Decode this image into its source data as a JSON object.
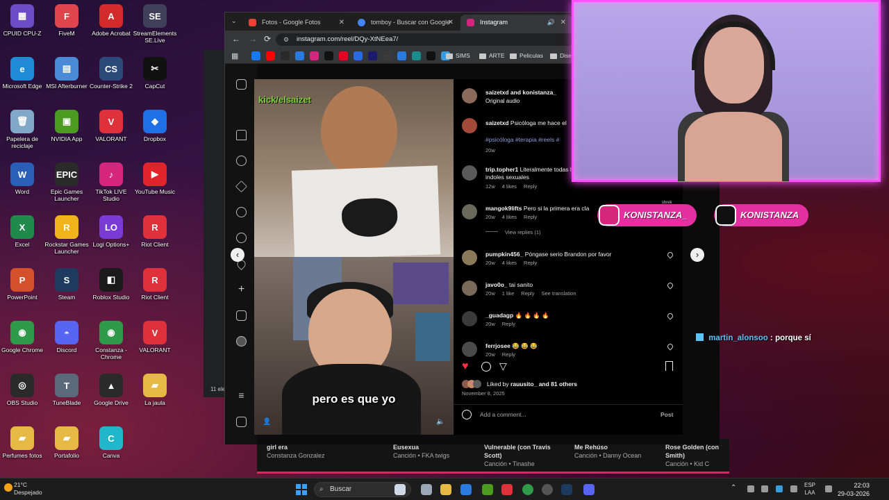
{
  "desktop": {
    "icons": [
      {
        "label": "CPUID CPU-Z",
        "color": "#6d4cc7",
        "glyph": "▦",
        "col": 0,
        "row": 0
      },
      {
        "label": "FiveM",
        "color": "#e0454b",
        "glyph": "F",
        "col": 1,
        "row": 0
      },
      {
        "label": "Adobe Acrobat",
        "color": "#d42a2a",
        "glyph": "A",
        "col": 2,
        "row": 0
      },
      {
        "label": "StreamElements SE.Live",
        "color": "#3f3f5a",
        "glyph": "SE",
        "col": 3,
        "row": 0
      },
      {
        "label": "Microsoft Edge",
        "color": "#1f8ad6",
        "glyph": "e",
        "col": 0,
        "row": 1
      },
      {
        "label": "MSI Afterburner",
        "color": "#4a8bd6",
        "glyph": "▤",
        "col": 1,
        "row": 1
      },
      {
        "label": "Counter-Strike 2",
        "color": "#2b4a7a",
        "glyph": "CS",
        "col": 2,
        "row": 1
      },
      {
        "label": "CapCut",
        "color": "#111111",
        "glyph": "✂",
        "col": 3,
        "row": 1
      },
      {
        "label": "Papelera de reciclaje",
        "color": "#7fa8c9",
        "glyph": "🗑",
        "col": 0,
        "row": 2
      },
      {
        "label": "NVIDIA App",
        "color": "#4a9b1f",
        "glyph": "▣",
        "col": 1,
        "row": 2
      },
      {
        "label": "VALORANT",
        "color": "#e0303a",
        "glyph": "V",
        "col": 2,
        "row": 2
      },
      {
        "label": "Dropbox",
        "color": "#1f6fe6",
        "glyph": "◆",
        "col": 3,
        "row": 2
      },
      {
        "label": "Word",
        "color": "#2a5fb8",
        "glyph": "W",
        "col": 0,
        "row": 3
      },
      {
        "label": "Epic Games Launcher",
        "color": "#2a2a2a",
        "glyph": "EPIC",
        "col": 1,
        "row": 3
      },
      {
        "label": "TikTok LIVE Studio",
        "color": "#d6257c",
        "glyph": "♪",
        "col": 2,
        "row": 3
      },
      {
        "label": "YouTube Music",
        "color": "#e0252a",
        "glyph": "▶",
        "col": 3,
        "row": 3
      },
      {
        "label": "Excel",
        "color": "#1f8a4a",
        "glyph": "X",
        "col": 0,
        "row": 4
      },
      {
        "label": "Rockstar Games Launcher",
        "color": "#f2b31a",
        "glyph": "R",
        "col": 1,
        "row": 4
      },
      {
        "label": "Logi Options+",
        "color": "#7a3ad6",
        "glyph": "LO",
        "col": 2,
        "row": 4
      },
      {
        "label": "Riot Client",
        "color": "#e0303a",
        "glyph": "R",
        "col": 3,
        "row": 4
      },
      {
        "label": "PowerPoint",
        "color": "#d4502a",
        "glyph": "P",
        "col": 0,
        "row": 5
      },
      {
        "label": "Steam",
        "color": "#1e3a5e",
        "glyph": "S",
        "col": 1,
        "row": 5
      },
      {
        "label": "Roblox Studio",
        "color": "#1a1a1a",
        "glyph": "◧",
        "col": 2,
        "row": 5
      },
      {
        "label": "Riot Client",
        "color": "#e0303a",
        "glyph": "R",
        "col": 3,
        "row": 5
      },
      {
        "label": "Google Chrome",
        "color": "#2f9a4a",
        "glyph": "◉",
        "col": 0,
        "row": 6
      },
      {
        "label": "Discord",
        "color": "#5865f2",
        "glyph": "◓",
        "col": 1,
        "row": 6
      },
      {
        "label": "Constanza - Chrome",
        "color": "#2f9a4a",
        "glyph": "◉",
        "col": 2,
        "row": 6
      },
      {
        "label": "VALORANT",
        "color": "#e0303a",
        "glyph": "V",
        "col": 3,
        "row": 6
      },
      {
        "label": "OBS Studio",
        "color": "#2a2a2a",
        "glyph": "◎",
        "col": 0,
        "row": 7
      },
      {
        "label": "TuneBlade",
        "color": "#5a6a7a",
        "glyph": "T",
        "col": 1,
        "row": 7
      },
      {
        "label": "Google Drive",
        "color": "#2a2a2a",
        "glyph": "▲",
        "col": 2,
        "row": 7
      },
      {
        "label": "La jaula",
        "color": "#e6b844",
        "glyph": "▰",
        "col": 3,
        "row": 7
      },
      {
        "label": "Perfumes fotos",
        "color": "#e6b844",
        "glyph": "▰",
        "col": 0,
        "row": 8
      },
      {
        "label": "Portafolio",
        "color": "#e6b844",
        "glyph": "▰",
        "col": 1,
        "row": 8
      },
      {
        "label": "Canva",
        "color": "#21b6c9",
        "glyph": "C",
        "col": 2,
        "row": 8
      }
    ]
  },
  "browser": {
    "tabs": [
      {
        "label": "Fotos - Google Fotos",
        "fav": "#ea4335"
      },
      {
        "label": "tomboy - Buscar con Google",
        "fav": "#4285f4"
      },
      {
        "label": "Instagram",
        "fav": "#d6257c"
      }
    ],
    "url": "instagram.com/reel/DQy-XtNEea7/",
    "bookmarks": [
      "SIMS",
      "ARTE",
      "Peliculas",
      "Diseñ"
    ]
  },
  "reel": {
    "overlay_tag": "kick/elsaizet",
    "subtitle": "pero es que yo",
    "header_user": "saizetxd and konistanza_",
    "header_audio": "Original audio",
    "caption_user": "saizetxd",
    "caption_text": "Psicóloga me hace el",
    "caption_tags": "#psicóloga #terapia #reels #",
    "caption_time": "20w",
    "comments": [
      {
        "user": "trip.topher1",
        "text": "Literalmente todas l",
        "line2": "indoles sexuales",
        "time": "12w",
        "likes": "4 likes",
        "reply": "Reply",
        "av": "#5a5a5a"
      },
      {
        "user": "mangok9lifts",
        "text": "Pero si la primera era cla",
        "time": "20w",
        "likes": "4 likes",
        "reply": "Reply",
        "av": "#6a6a5a",
        "replies": "View replies (1)"
      },
      {
        "user": "pumpkin456_",
        "text": "Póngase serio Brandon por favor",
        "time": "20w",
        "likes": "4 likes",
        "reply": "Reply",
        "av": "#8a7a5a"
      },
      {
        "user": "javo0o_",
        "text": "tai sanito",
        "time": "20w",
        "likes": "1 like",
        "reply": "Reply",
        "extra": "See translation",
        "av": "#7a6a5a"
      },
      {
        "user": "_guadagp",
        "text": "🔥 🔥 🔥 🔥",
        "time": "20w",
        "reply": "Reply",
        "av": "#3a3a3a"
      },
      {
        "user": "ferrjosee",
        "text": "😂 😂 😂",
        "time": "20w",
        "reply": "Reply",
        "av": "#4a4a4a"
      }
    ],
    "liked_by": "Liked by",
    "liked_user": "rauusito_",
    "liked_others": "and 81 others",
    "date": "November 8, 2025",
    "add_comment": "Add a comment...",
    "post_label": "Post"
  },
  "stream": {
    "badge_ig": "KONISTANZA_",
    "badge_tiktok": "KONISTANZA",
    "shrek_label": "shrek",
    "chat_user": "martin_alonsoo",
    "chat_sep": ":",
    "chat_text": "porque sí"
  },
  "music": {
    "items": [
      {
        "title": "girl era",
        "sub": "Constanza Gonzalez"
      },
      {
        "title": "Eusexua",
        "sub": "Canción • FKA twigs"
      },
      {
        "title": "Vulnerable (con Travis Scott)",
        "sub": "Canción • Tinashe"
      },
      {
        "title": "Me Rehúso",
        "sub": "Canción • Danny Ocean"
      },
      {
        "title": "Rose Golden (con Smith)",
        "sub": "Canción • Kid C"
      }
    ]
  },
  "taskbar": {
    "temp": "21°C",
    "weather": "Despejado",
    "search": "Buscar",
    "lang1": "ESP",
    "lang2": "LAA",
    "time": "22:03",
    "date": "29-03-2026",
    "side_count": "11 ele"
  },
  "colors": {
    "accent_pink": "#ff4fff",
    "instagram_heart": "#ff3040",
    "chat_name": "#5ec2f5"
  }
}
